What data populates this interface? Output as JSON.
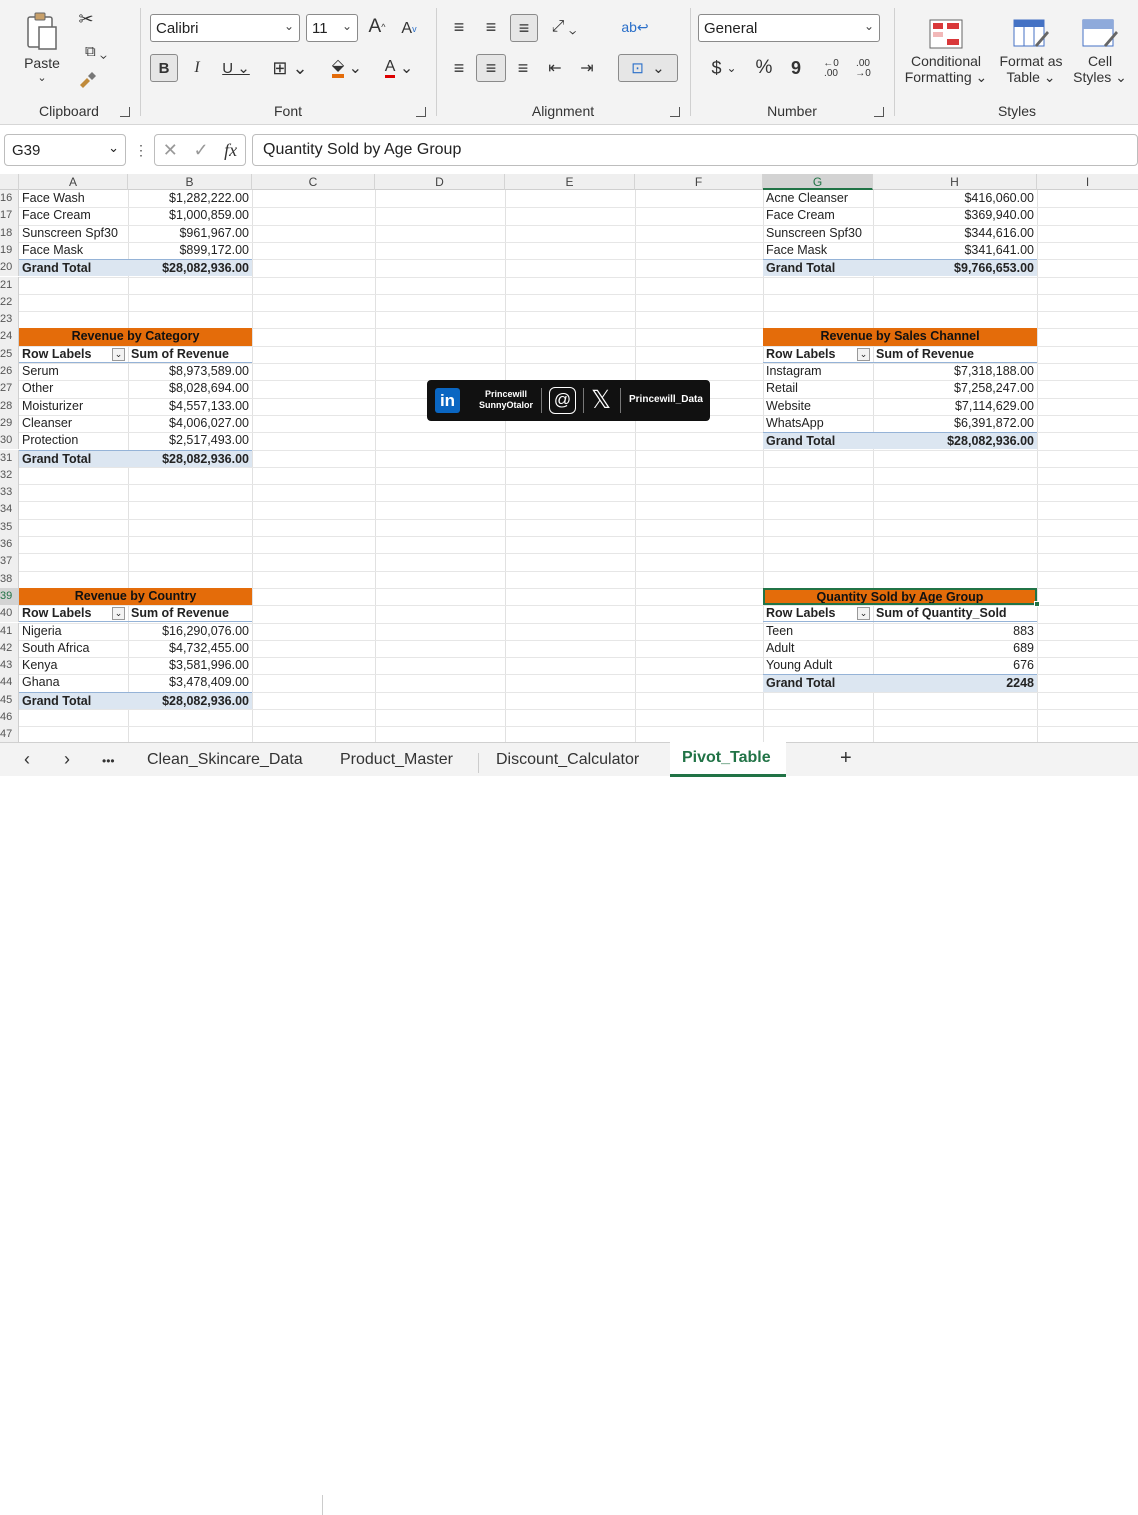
{
  "ribbon": {
    "clipboard": {
      "label": "Clipboard",
      "paste": "Paste"
    },
    "font": {
      "label": "Font",
      "name": "Calibri",
      "size": "11",
      "grow": "A",
      "shrink": "A",
      "bold": "B",
      "italic": "I",
      "underline": "U",
      "fontcolor": "A"
    },
    "alignment": {
      "label": "Alignment"
    },
    "number": {
      "label": "Number",
      "format": "General",
      "currency": "$",
      "percent": "%",
      "comma": "9",
      "incdec": "←0 .00",
      "decdec": ".00 →0"
    },
    "styles": {
      "label": "Styles",
      "conditional": "Conditional",
      "conditional2": "Formatting",
      "formatas": "Format as",
      "formatas2": "Table",
      "cell": "Cell",
      "cell2": "Styles"
    }
  },
  "formula": {
    "namebox": "G39",
    "fx": "fx",
    "content": "Quantity Sold by Age Group"
  },
  "columns": [
    "A",
    "B",
    "C",
    "D",
    "E",
    "F",
    "G",
    "H",
    "I"
  ],
  "rows": [
    "16",
    "17",
    "18",
    "19",
    "20",
    "21",
    "22",
    "23",
    "24",
    "25",
    "26",
    "27",
    "28",
    "29",
    "30",
    "31",
    "32",
    "33",
    "34",
    "35",
    "36",
    "37",
    "38",
    "39",
    "40",
    "41",
    "42",
    "43",
    "44",
    "45",
    "46",
    "47"
  ],
  "top_left": [
    {
      "label": "Face Wash",
      "value": "$1,282,222.00"
    },
    {
      "label": "Face Cream",
      "value": "$1,000,859.00"
    },
    {
      "label": "Sunscreen Spf30",
      "value": "$961,967.00"
    },
    {
      "label": "Face Mask",
      "value": "$899,172.00"
    },
    {
      "label": "Grand Total",
      "value": "$28,082,936.00"
    }
  ],
  "top_right": [
    {
      "label": "Acne Cleanser",
      "value": "$416,060.00"
    },
    {
      "label": "Face Cream",
      "value": "$369,940.00"
    },
    {
      "label": "Sunscreen Spf30",
      "value": "$344,616.00"
    },
    {
      "label": "Face Mask",
      "value": "$341,641.00"
    },
    {
      "label": "Grand Total",
      "value": "$9,766,653.00"
    }
  ],
  "category": {
    "title": "Revenue by Category",
    "col1": "Row Labels",
    "col2": "Sum of Revenue",
    "rows": [
      {
        "label": "Serum",
        "value": "$8,973,589.00"
      },
      {
        "label": "Other",
        "value": "$8,028,694.00"
      },
      {
        "label": "Moisturizer",
        "value": "$4,557,133.00"
      },
      {
        "label": "Cleanser",
        "value": "$4,006,027.00"
      },
      {
        "label": "Protection",
        "value": "$2,517,493.00"
      }
    ],
    "total": {
      "label": "Grand Total",
      "value": "$28,082,936.00"
    }
  },
  "channel": {
    "title": "Revenue by Sales Channel",
    "col1": "Row Labels",
    "col2": "Sum of Revenue",
    "rows": [
      {
        "label": "Instagram",
        "value": "$7,318,188.00"
      },
      {
        "label": "Retail",
        "value": "$7,258,247.00"
      },
      {
        "label": "Website",
        "value": "$7,114,629.00"
      },
      {
        "label": "WhatsApp",
        "value": "$6,391,872.00"
      }
    ],
    "total": {
      "label": "Grand Total",
      "value": "$28,082,936.00"
    }
  },
  "country": {
    "title": "Revenue by Country",
    "col1": "Row Labels",
    "col2": "Sum of Revenue",
    "rows": [
      {
        "label": "Nigeria",
        "value": "$16,290,076.00"
      },
      {
        "label": "South Africa",
        "value": "$4,732,455.00"
      },
      {
        "label": "Kenya",
        "value": "$3,581,996.00"
      },
      {
        "label": "Ghana",
        "value": "$3,478,409.00"
      }
    ],
    "total": {
      "label": "Grand Total",
      "value": "$28,082,936.00"
    }
  },
  "age": {
    "title": "Quantity Sold by Age Group",
    "col1": "Row Labels",
    "col2": "Sum of Quantity_Sold",
    "rows": [
      {
        "label": "Teen",
        "value": "883"
      },
      {
        "label": "Adult",
        "value": "689"
      },
      {
        "label": "Young Adult",
        "value": "676"
      }
    ],
    "total": {
      "label": "Grand Total",
      "value": "2248"
    }
  },
  "watermark": {
    "name1": "Princewill",
    "name2": "SunnyOtalor",
    "handle": "Princewill_Data"
  },
  "tabs": [
    "Clean_Skincare_Data",
    "Product_Master",
    "Discount_Calculator",
    "Pivot_Table"
  ],
  "tabs_active": "Pivot_Table",
  "tabs_more": "•••",
  "tabs_add": "+"
}
